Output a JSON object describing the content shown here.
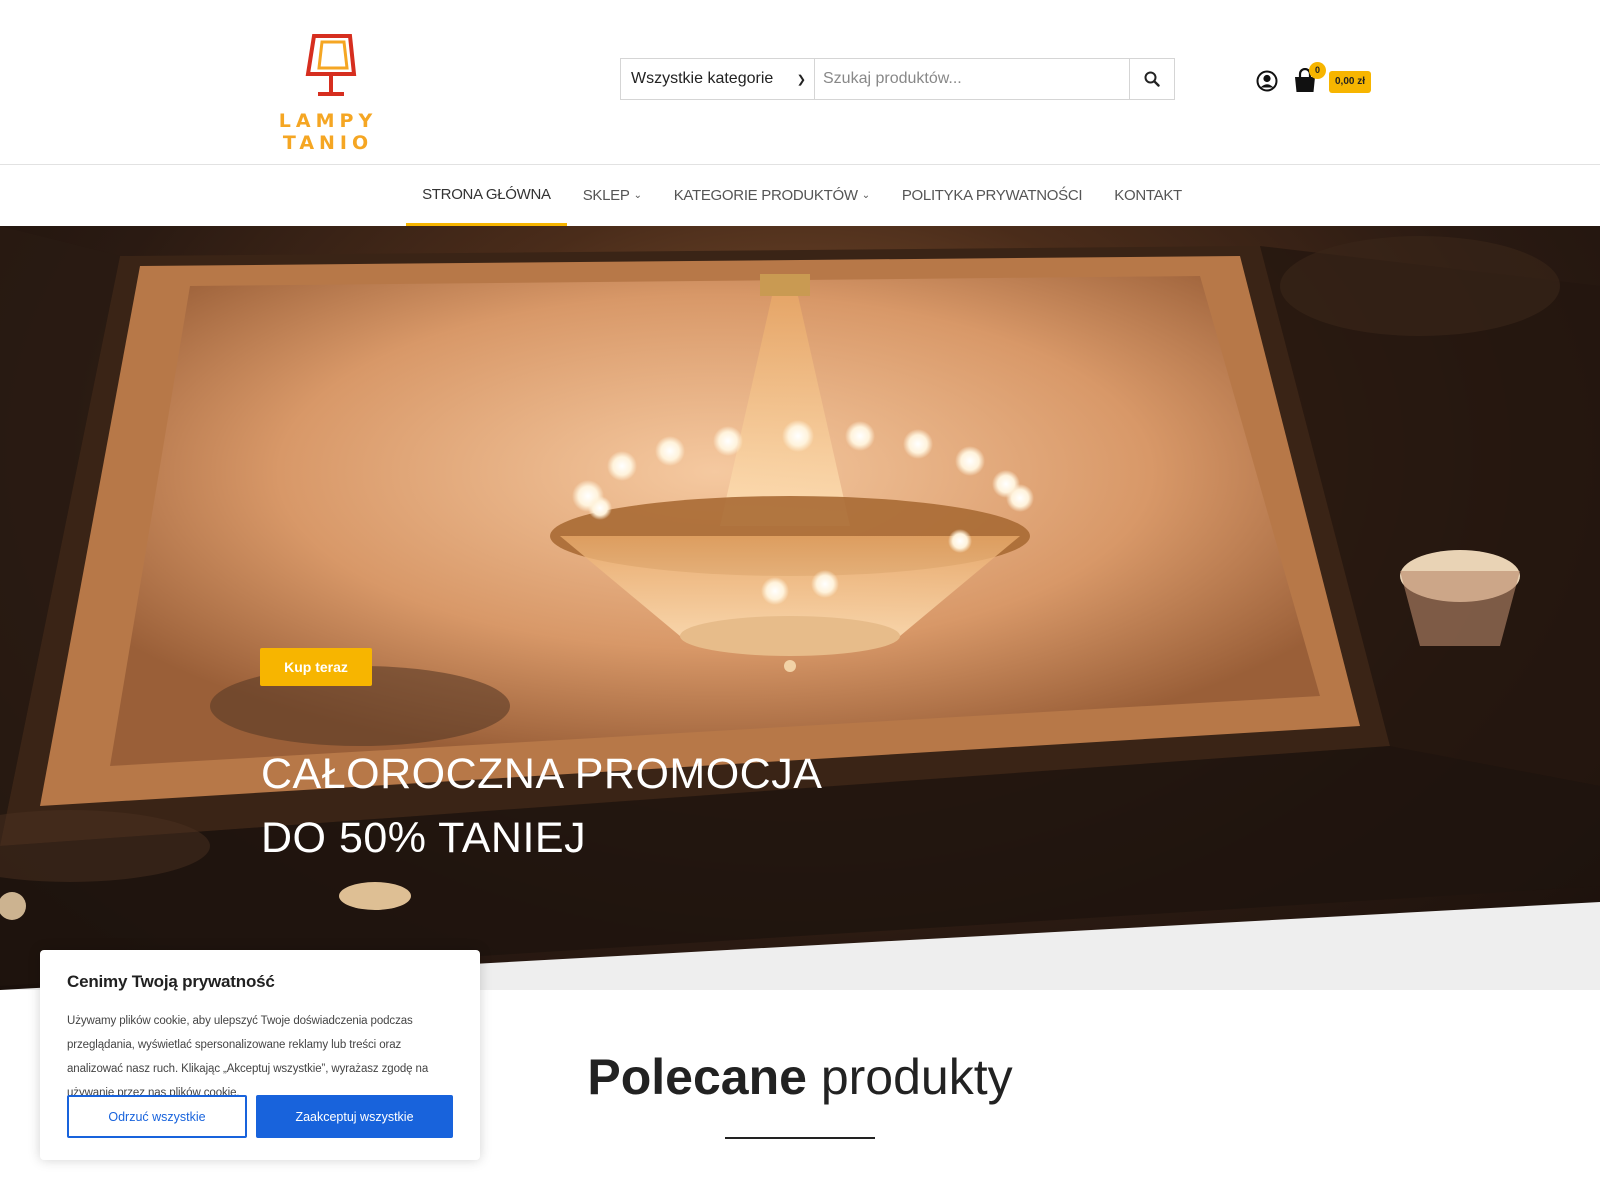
{
  "brand": {
    "name": "LAMPY TANIO",
    "logo_color": "#f5a623",
    "logo_lamp_color": "#d62e1f"
  },
  "search": {
    "category_selected": "Wszystkie kategorie",
    "placeholder": "Szukaj produktów..."
  },
  "header_icons": {
    "account": "user-circle-icon",
    "cart": "shopping-bag-icon",
    "cart_count": "0",
    "cart_total": "0,00 zł"
  },
  "nav": {
    "items": [
      {
        "label": "STRONA GŁÓWNA",
        "active": true,
        "has_dropdown": false
      },
      {
        "label": "SKLEP",
        "active": false,
        "has_dropdown": true
      },
      {
        "label": "KATEGORIE PRODUKTÓW",
        "active": false,
        "has_dropdown": true
      },
      {
        "label": "POLITYKA PRYWATNOŚCI",
        "active": false,
        "has_dropdown": false
      },
      {
        "label": "KONTAKT",
        "active": false,
        "has_dropdown": false
      }
    ]
  },
  "hero": {
    "line1": "CAŁOROCZNA PROMOCJA",
    "line2": "DO 50% TANIEJ",
    "button": "Kup teraz",
    "accent": "#f7b500"
  },
  "featured": {
    "title_bold": "Polecane",
    "title_rest": "produkty"
  },
  "cookie": {
    "title": "Cenimy Twoją prywatność",
    "text": "Używamy plików cookie, aby ulepszyć Twoje doświadczenia podczas przeglądania, wyświetlać spersonalizowane reklamy lub treści oraz analizować nasz ruch. Klikając „Akceptuj wszystkie”, wyrażasz zgodę na używanie przez nas plików cookie.",
    "reject": "Odrzuć wszystkie",
    "accept": "Zaakceptuj wszystkie",
    "button_color": "#1863dc"
  }
}
